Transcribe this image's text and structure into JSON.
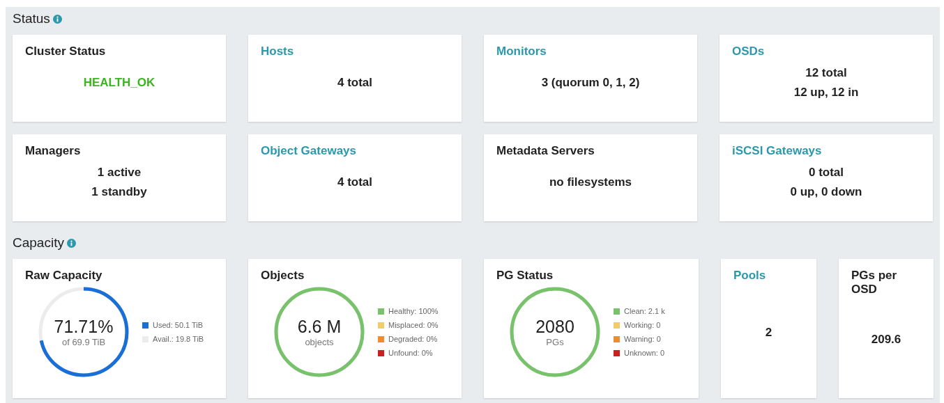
{
  "sections": [
    {
      "title": "Status",
      "kind": "four",
      "cards": [
        {
          "kind": "health",
          "title": "Cluster Status",
          "link": false,
          "lines": [
            "HEALTH_OK"
          ]
        },
        {
          "kind": "text",
          "title": "Hosts",
          "link": true,
          "lines": [
            "4 total"
          ]
        },
        {
          "kind": "text",
          "title": "Monitors",
          "link": true,
          "lines": [
            "3 (quorum 0, 1, 2)"
          ]
        },
        {
          "kind": "text",
          "title": "OSDs",
          "link": true,
          "lines": [
            "12 total",
            "12 up, 12 in"
          ]
        },
        {
          "kind": "text",
          "title": "Managers",
          "link": false,
          "lines": [
            "1 active",
            "1 standby"
          ]
        },
        {
          "kind": "text",
          "title": "Object Gateways",
          "link": true,
          "lines": [
            "4 total"
          ]
        },
        {
          "kind": "text",
          "title": "Metadata Servers",
          "link": false,
          "lines": [
            "no filesystems"
          ]
        },
        {
          "kind": "text",
          "title": "iSCSI Gateways",
          "link": true,
          "lines": [
            "0 total",
            "0 up, 0 down"
          ]
        }
      ]
    },
    {
      "title": "Capacity",
      "kind": "capacity",
      "cards": [
        {
          "kind": "donut",
          "title": "Raw Capacity",
          "link": false,
          "value": "71.71%",
          "sub": "of 69.9 TiB",
          "level": 0.7171,
          "color": "#1a6fd6",
          "legend": [
            {
              "label": "Used: 50.1 TiB",
              "color": "#1a6fd6"
            },
            {
              "label": "Avail.: 19.8 TiB",
              "color": "#ececec"
            }
          ]
        },
        {
          "kind": "donut",
          "title": "Objects",
          "link": false,
          "value": "6.6 M",
          "sub": "objects",
          "level": 1,
          "color": "#77c26a",
          "legend": [
            {
              "label": "Healthy: 100%",
              "color": "#77c26a"
            },
            {
              "label": "Misplaced: 0%",
              "color": "#f3cc6a"
            },
            {
              "label": "Degraded: 0%",
              "color": "#ef8c2c"
            },
            {
              "label": "Unfound: 0%",
              "color": "#cc1f1f"
            }
          ]
        },
        {
          "kind": "donut",
          "title": "PG Status",
          "link": false,
          "value": "2080",
          "sub": "PGs",
          "level": 1,
          "color": "#77c26a",
          "legend": [
            {
              "label": "Clean: 2.1 k",
              "color": "#77c26a"
            },
            {
              "label": "Working: 0",
              "color": "#f3cc6a"
            },
            {
              "label": "Warning: 0",
              "color": "#ef8c2c"
            },
            {
              "label": "Unknown: 0",
              "color": "#cc1f1f"
            }
          ]
        },
        {
          "kind": "text",
          "title": "Pools",
          "link": true,
          "lines": [
            "2"
          ]
        },
        {
          "kind": "text",
          "title": "PGs per OSD",
          "link": false,
          "lines": [
            "209.6"
          ]
        }
      ]
    }
  ]
}
